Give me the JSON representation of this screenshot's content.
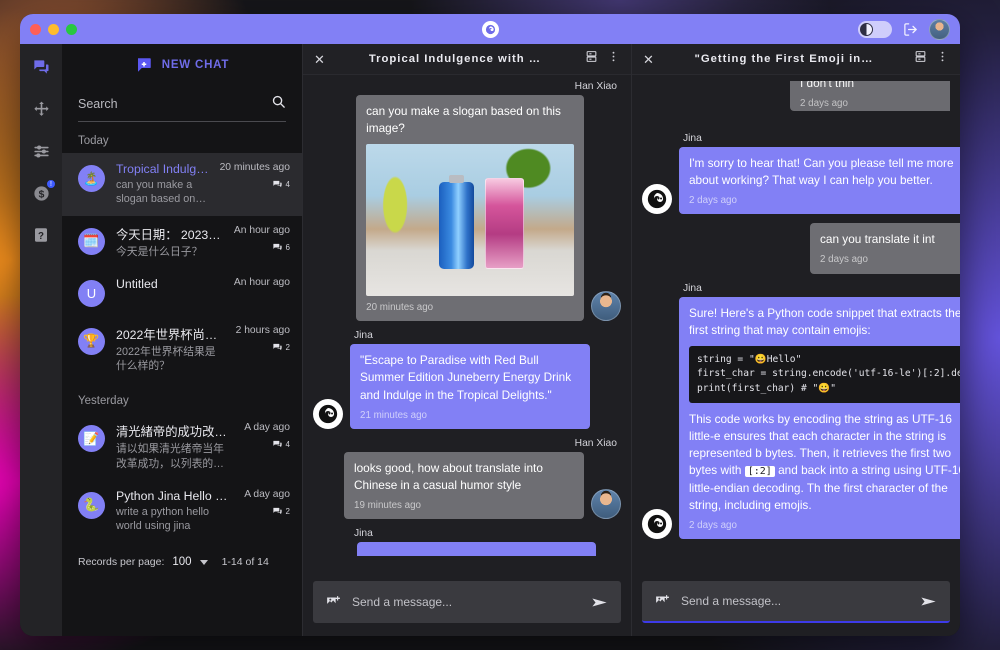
{
  "titlebar": {
    "logo_icon": "jina-logo-icon",
    "theme_toggle_icon": "theme-toggle-icon",
    "logout_icon": "logout-icon",
    "avatar_icon": "user-avatar"
  },
  "rail": {
    "items": [
      {
        "icon": "chat-bubbles-icon",
        "name": "rail-item-chats",
        "active": true,
        "badge": ""
      },
      {
        "icon": "move-arrows-icon",
        "name": "rail-item-move",
        "active": false,
        "badge": ""
      },
      {
        "icon": "sliders-icon",
        "name": "rail-item-settings",
        "active": false,
        "badge": ""
      },
      {
        "icon": "dollar-coin-icon",
        "name": "rail-item-billing",
        "active": false,
        "badge": "!"
      },
      {
        "icon": "help-question-icon",
        "name": "rail-item-help",
        "active": false,
        "badge": ""
      }
    ]
  },
  "sidebar": {
    "new_chat_label": "NEW CHAT",
    "search": {
      "placeholder": "Search",
      "value": ""
    },
    "sections": [
      {
        "label": "Today",
        "items": [
          {
            "avatar_emoji": "🏝️",
            "title": "Tropical Indulg…",
            "preview": "can you make a slogan based on…",
            "time": "20 minutes ago",
            "count": "4",
            "selected": true
          },
          {
            "avatar_emoji": "🗓️",
            "title": "今天日期： 2023年…",
            "preview": "今天是什么日子？",
            "time": "An hour ago",
            "count": "6",
            "selected": false
          },
          {
            "avatar_emoji": "U",
            "title": "Untitled",
            "preview": "",
            "time": "An hour ago",
            "count": "",
            "selected": false
          },
          {
            "avatar_emoji": "🏆",
            "title": "2022年世界杯尚未…",
            "preview": "2022年世界杯结果是什么样的？",
            "time": "2 hours ago",
            "count": "2",
            "selected": false
          }
        ]
      },
      {
        "label": "Yesterday",
        "items": [
          {
            "avatar_emoji": "📝",
            "title": "清光緒帝的成功改革…",
            "preview": "请以如果清光绪帝当年改革成功，以列表的方式…",
            "time": "A day ago",
            "count": "4",
            "selected": false
          },
          {
            "avatar_emoji": "🐍",
            "title": "Python Jina Hello Wo…",
            "preview": "write a python hello world using jina",
            "time": "A day ago",
            "count": "2",
            "selected": false
          }
        ]
      }
    ],
    "pager": {
      "label": "Records per page:",
      "value": "100",
      "range": "1-14 of 14"
    }
  },
  "panels": [
    {
      "name": "panel-tropical",
      "title": "Tropical Indulgence with …",
      "close_icon": "close-icon",
      "split_icon": "split-view-icon",
      "menu_icon": "more-vertical-icon",
      "composer": {
        "placeholder": "Send a message...",
        "value": "",
        "image_icon": "add-image-icon",
        "send_icon": "send-icon",
        "focused": false
      },
      "messages": [
        {
          "role": "user",
          "sender": "Han Xiao",
          "text": "can you make a slogan based on this image?",
          "time": "20 minutes ago",
          "image": "red-bull-summer-edition-beach-photo"
        },
        {
          "role": "bot",
          "sender": "Jina",
          "text": "\"Escape to Paradise with Red Bull Summer Edition Juneberry Energy Drink and Indulge in the Tropical Delights.\"",
          "time": "21 minutes ago"
        },
        {
          "role": "user",
          "sender": "Han Xiao",
          "text": "looks good, how about translate into Chinese in a casual humor style",
          "time": "19 minutes ago"
        },
        {
          "role": "bot",
          "sender": "Jina",
          "text": "",
          "time": ""
        }
      ]
    },
    {
      "name": "panel-emoji",
      "title": "\"Getting the First Emoji in…",
      "close_icon": "close-icon",
      "split_icon": "split-view-icon",
      "menu_icon": "more-vertical-icon",
      "composer": {
        "placeholder": "Send a message...",
        "value": "",
        "image_icon": "add-image-icon",
        "send_icon": "send-icon",
        "focused": true
      },
      "messages": [
        {
          "role": "user",
          "sender": "",
          "text": "I don't thin",
          "time": "2 days ago",
          "clipped": true
        },
        {
          "role": "bot",
          "sender": "Jina",
          "text": "I'm sorry to hear that! Can you please tell me more about working? That way I can help you better.",
          "time": "2 days ago"
        },
        {
          "role": "user",
          "sender": "",
          "text": "can you translate it int",
          "time": "2 days ago"
        },
        {
          "role": "bot",
          "sender": "Jina",
          "text": "Sure! Here's a Python code snippet that extracts the first string that may contain emojis:",
          "code": "string = \"😀Hello\"\nfirst_char = string.encode('utf-16-le')[:2].deco\nprint(first_char) # \"😀\"",
          "explain_1": "This code works by encoding the string as UTF-16 little-e ensures that each character in the string is represented b bytes. Then, it retrieves the first two bytes with ",
          "explain_kbd": "[:2]",
          "explain_2": " and back into a string using UTF-16 little-endian decoding. Th the first character of the string, including emojis.",
          "time": "2 days ago"
        }
      ]
    }
  ]
}
